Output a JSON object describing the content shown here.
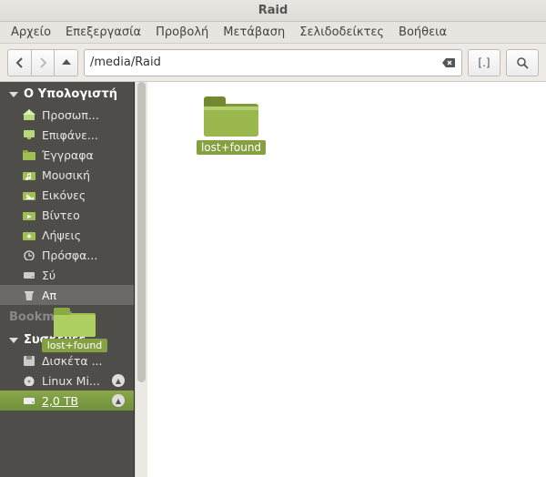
{
  "window": {
    "title": "Raid"
  },
  "menubar": [
    "Αρχείο",
    "Επεξεργασία",
    "Προβολή",
    "Μετάβαση",
    "Σελιδοδείκτες",
    "Βοήθεια"
  ],
  "toolbar": {
    "path": "/media/Raid",
    "fit_label": "[.]"
  },
  "sidebar": {
    "sections": [
      {
        "title": "Ο Υπολογιστή",
        "items": [
          {
            "icon": "home",
            "label": "Προσωπ..."
          },
          {
            "icon": "desktop",
            "label": "Επιφάνε..."
          },
          {
            "icon": "folder",
            "label": "Έγγραφα"
          },
          {
            "icon": "music",
            "label": "Μουσική"
          },
          {
            "icon": "pictures",
            "label": "Εικόνες"
          },
          {
            "icon": "video",
            "label": "Βίντεο"
          },
          {
            "icon": "downloads",
            "label": "Λήψεις"
          },
          {
            "icon": "recent",
            "label": "Πρόσφα..."
          },
          {
            "icon": "filesystem",
            "label": "Σύ"
          },
          {
            "icon": "trash",
            "label": "Απ",
            "drop": true
          }
        ]
      },
      {
        "title": "Bookmarks",
        "items": []
      },
      {
        "title": "Συσκευές",
        "items": [
          {
            "icon": "floppy",
            "label": "Δισκέτα ..."
          },
          {
            "icon": "optical",
            "label": "Linux Mi...",
            "eject": true
          },
          {
            "icon": "drive",
            "label": "2,0 TB",
            "eject": true,
            "selected": true
          }
        ]
      }
    ]
  },
  "content": {
    "items": [
      {
        "type": "folder",
        "name": "lost+found"
      }
    ]
  },
  "drag_ghost": {
    "name": "lost+found"
  }
}
